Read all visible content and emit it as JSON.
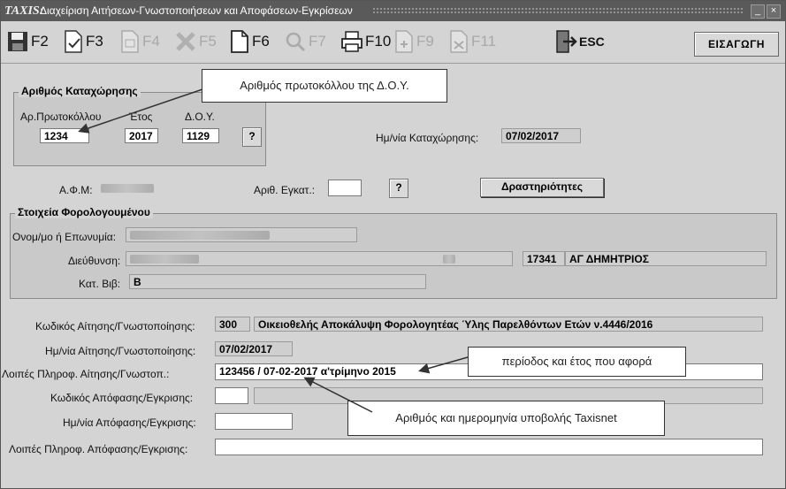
{
  "window": {
    "logo": "TAXIS:",
    "title": "Διαχείριση Αιτήσεων-Γνωστοποιήσεων και Αποφάσεων-Εγκρίσεων",
    "controls": [
      "_",
      "×"
    ]
  },
  "toolbar": {
    "buttons": [
      {
        "key": "F2",
        "icon": "save-icon",
        "enabled": true
      },
      {
        "key": "F3",
        "icon": "document-edit-icon",
        "enabled": true
      },
      {
        "key": "F4",
        "icon": "document-copy-icon",
        "enabled": false
      },
      {
        "key": "F5",
        "icon": "delete-icon",
        "enabled": false
      },
      {
        "key": "F6",
        "icon": "document-icon",
        "enabled": true
      },
      {
        "key": "F7",
        "icon": "search-icon",
        "enabled": false
      },
      {
        "key": "F10",
        "icon": "printer-icon",
        "enabled": true
      },
      {
        "key": "F9",
        "icon": "add-document-icon",
        "enabled": false
      },
      {
        "key": "F11",
        "icon": "remove-document-icon",
        "enabled": false
      },
      {
        "key": "ESC",
        "icon": "exit-icon",
        "enabled": true
      }
    ],
    "insert_label": "ΕΙΣΑΓΩΓΗ"
  },
  "registration": {
    "group_title": "Αριθμός Καταχώρησης",
    "protocol_label": "Αρ.Πρωτοκόλλου",
    "year_label": "Έτος",
    "doy_label": "Δ.Ο.Υ.",
    "protocol_value": "1234",
    "year_value": "2017",
    "doy_value": "1129",
    "help_label": "?",
    "date_label": "Ημ/νία Καταχώρησης:",
    "date_value": "07/02/2017"
  },
  "afm": {
    "label": "Α.Φ.Μ:",
    "install_label": "Αριθ. Εγκατ.:",
    "install_value": "",
    "help_label": "?",
    "activities_label": "Δραστηριότητες"
  },
  "taxpayer": {
    "group_title": "Στοιχεία Φορολογουμένου",
    "name_label": "Ονομ/μο ή Επωνυμία:",
    "address_label": "Διεύθυνση:",
    "postcode_value": "17341",
    "city_value": "ΑΓ ΔΗΜΗΤΡΙΟΣ",
    "book_label": "Κατ. Βιβ:",
    "book_value": "Β"
  },
  "application": {
    "code_label": "Κωδικός Αίτησης/Γνωστοποίησης:",
    "code_value": "300",
    "code_desc": "Οικειοθελής Αποκάλυψη Φορολογητέας Ύλης Παρελθόντων Ετών ν.4446/2016",
    "date_label": "Ημ/νία Αίτησης/Γνωστοποίησης:",
    "date_value": "07/02/2017",
    "info_label": "Λοιπές Πληροφ. Αίτησης/Γνωστοπ.:",
    "info_value": "123456 / 07-02-2017      α'τρίμηνο 2015"
  },
  "decision": {
    "code_label": "Κωδικός Απόφασης/Εγκρισης:",
    "code_value": "",
    "date_label": "Ημ/νία Απόφασης/Εγκρισης:",
    "date_value": "",
    "info_label": "Λοιπές Πληροφ. Απόφασης/Εγκρισης:",
    "info_value": ""
  },
  "callouts": {
    "protocol_note": "Αριθμός πρωτοκόλλου της Δ.Ο.Υ.",
    "period_note": "περίοδος και έτος που αφορά",
    "taxisnet_note": "Αριθμός και ημερομηνία  υποβολής Taxisnet"
  }
}
